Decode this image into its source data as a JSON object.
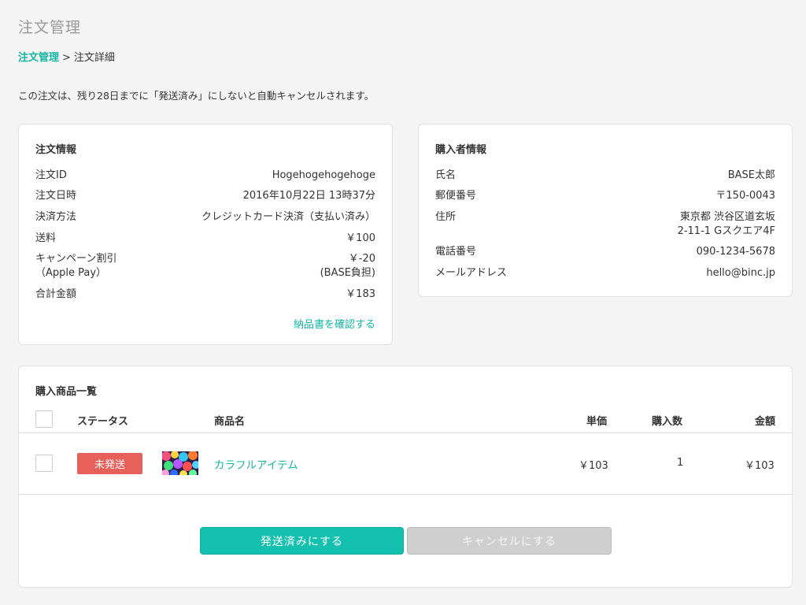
{
  "page": {
    "title": "注文管理",
    "breadcrumb": {
      "parent": "注文管理",
      "separator": ">",
      "current": "注文詳細"
    },
    "notice": "この注文は、残り28日までに「発送済み」にしないと自動キャンセルされます。"
  },
  "order_info": {
    "title": "注文情報",
    "rows": [
      {
        "label": "注文ID",
        "value": "Hogehogehogehoge"
      },
      {
        "label": "注文日時",
        "value": "2016年10月22日 13時37分"
      },
      {
        "label": "決済方法",
        "value": "クレジットカード決済（支払い済み）"
      },
      {
        "label": "送料",
        "value": "￥100"
      },
      {
        "label": "キャンペーン割引",
        "label2": "（Apple Pay）",
        "value": "￥-20",
        "value2": "(BASE負担)"
      },
      {
        "label": "合計金額",
        "value": "￥183"
      }
    ],
    "invoice_link": "納品書を確認する"
  },
  "buyer_info": {
    "title": "購入者情報",
    "rows": [
      {
        "label": "氏名",
        "value": "BASE太郎"
      },
      {
        "label": "郵便番号",
        "value": "〒150-0043"
      },
      {
        "label": "住所",
        "value": "東京都 渋谷区道玄坂",
        "value2": "2-11-1 Gスクエア4F"
      },
      {
        "label": "電話番号",
        "value": "090-1234-5678"
      },
      {
        "label": "メールアドレス",
        "value": "hello@binc.jp"
      }
    ]
  },
  "items": {
    "title": "購入商品一覧",
    "columns": {
      "status": "ステータス",
      "name": "商品名",
      "unit_price": "単価",
      "quantity": "購入数",
      "amount": "金額"
    },
    "rows": [
      {
        "status": "未発送",
        "status_color": "#e8605a",
        "name": "カラフルアイテム",
        "unit_price": "￥103",
        "quantity": "1",
        "amount": "￥103"
      }
    ]
  },
  "actions": {
    "ship_label": "発送済みにする",
    "cancel_label": "キャンセルにする"
  },
  "colors": {
    "accent": "#13b5a3",
    "status_unshipped": "#e8605a",
    "button_disabled": "#cfcfcf"
  }
}
